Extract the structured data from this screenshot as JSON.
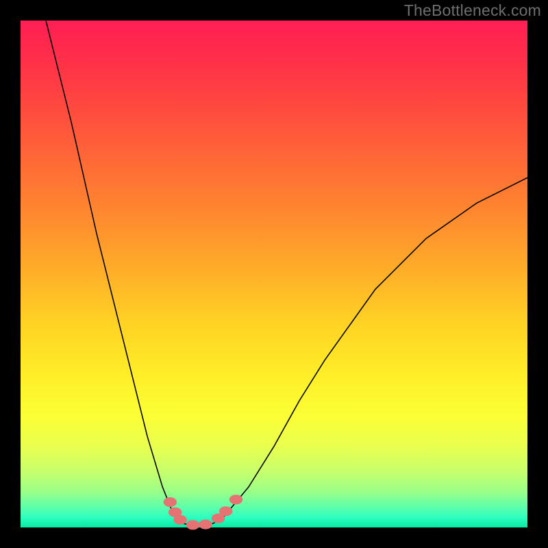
{
  "watermark": "TheBottleneck.com",
  "chart_data": {
    "type": "line",
    "title": "",
    "xlabel": "",
    "ylabel": "",
    "xlim": [
      0,
      100
    ],
    "ylim": [
      0,
      100
    ],
    "grid": false,
    "legend": false,
    "gradient_stops": [
      {
        "pct": 0,
        "color": "#ff1f54"
      },
      {
        "pct": 50,
        "color": "#ffb028"
      },
      {
        "pct": 78,
        "color": "#fbff35"
      },
      {
        "pct": 100,
        "color": "#06e9a3"
      }
    ],
    "series": [
      {
        "name": "left-branch",
        "stroke": "#000000",
        "x": [
          5,
          10,
          15,
          20,
          25,
          28,
          30,
          31,
          32
        ],
        "y": [
          100,
          80,
          58,
          38,
          18,
          8,
          3,
          1.5,
          0.8
        ]
      },
      {
        "name": "right-branch",
        "stroke": "#000000",
        "x": [
          38,
          40,
          45,
          50,
          55,
          60,
          70,
          80,
          90,
          100
        ],
        "y": [
          0.8,
          2,
          8,
          16,
          25,
          33,
          47,
          57,
          64,
          69
        ]
      },
      {
        "name": "valley-floor",
        "stroke": "#000000",
        "x": [
          32,
          34,
          36,
          38
        ],
        "y": [
          0.8,
          0.4,
          0.4,
          0.8
        ]
      }
    ],
    "markers": [
      {
        "name": "left-dot-1",
        "x": 29.5,
        "y": 5.0
      },
      {
        "name": "left-seg-1",
        "x": 30.5,
        "y": 3.0
      },
      {
        "name": "left-seg-2",
        "x": 31.5,
        "y": 1.5
      },
      {
        "name": "bottom-seg",
        "x": 34.0,
        "y": 0.5
      },
      {
        "name": "bottom-seg2",
        "x": 36.5,
        "y": 0.6
      },
      {
        "name": "right-seg-1",
        "x": 39.0,
        "y": 1.8
      },
      {
        "name": "right-seg-2",
        "x": 40.5,
        "y": 3.2
      },
      {
        "name": "right-dot-1",
        "x": 42.5,
        "y": 5.5
      }
    ],
    "marker_style": {
      "color": "#e57373",
      "radius": 1.2
    }
  }
}
